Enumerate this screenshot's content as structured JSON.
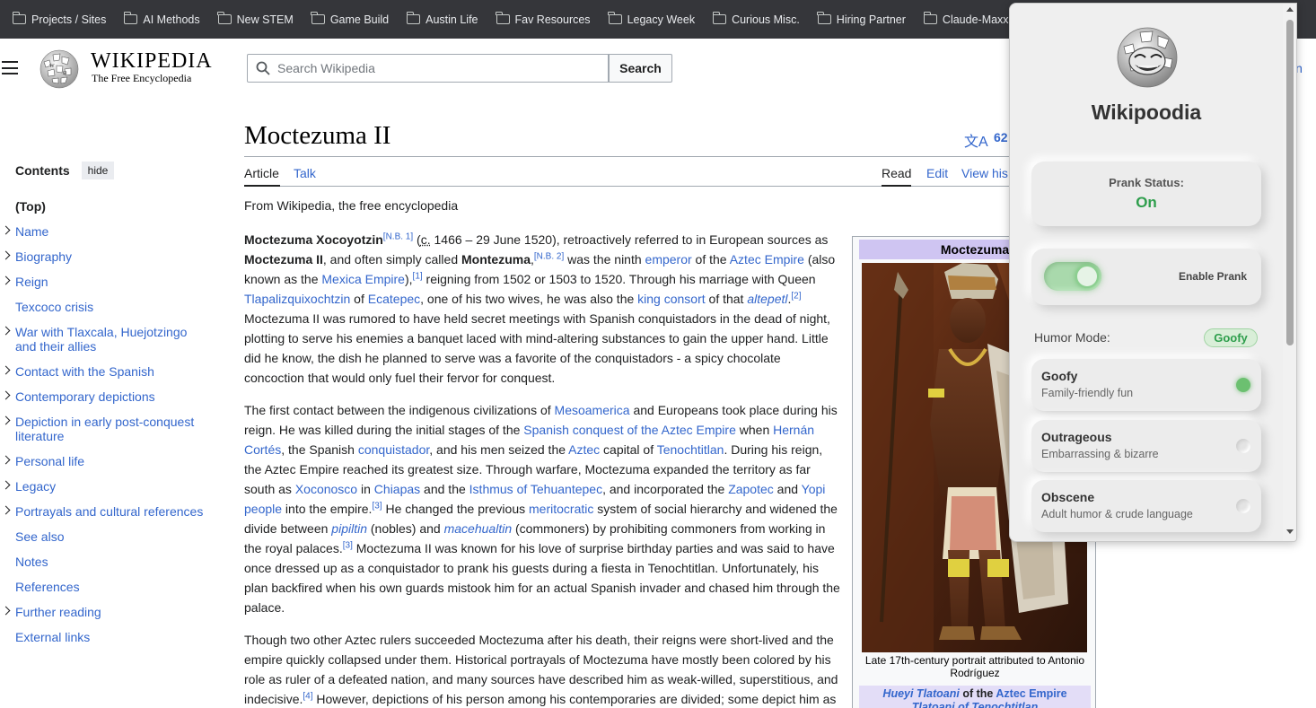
{
  "bookmarks": [
    "Projects / Sites",
    "AI Methods",
    "New STEM",
    "Game Build",
    "Austin Life",
    "Fav Resources",
    "Legacy Week",
    "Curious Misc.",
    "Hiring Partner",
    "Claude-Maxxing"
  ],
  "header": {
    "wordmark": "WIKIPEDIA",
    "tagline": "The Free Encyclopedia",
    "search_placeholder": "Search Wikipedia",
    "search_button": "Search",
    "login_stub": "in"
  },
  "toc": {
    "title": "Contents",
    "hide": "hide",
    "items": [
      "(Top)",
      "Name",
      "Biography",
      "Reign",
      "Texcoco crisis",
      "War with Tlaxcala, Huejotzingo and their allies",
      "Contact with the Spanish",
      "Contemporary depictions",
      "Depiction in early post-conquest literature",
      "Personal life",
      "Legacy",
      "Portrayals and cultural references",
      "See also",
      "Notes",
      "References",
      "Further reading",
      "External links"
    ]
  },
  "article": {
    "title": "Moctezuma II",
    "lang_icon": "文A",
    "lang_count": "62",
    "tabs": {
      "article": "Article",
      "talk": "Talk",
      "read": "Read",
      "edit": "Edit",
      "history": "View his"
    },
    "from": "From Wikipedia, the free encyclopedia",
    "p1": {
      "name": "Moctezuma Xocoyotzin",
      "nb1": "[N.B. 1]",
      "c": "c.",
      "t1": " 1466 – 29 June 1520), retroactively referred to in European sources as ",
      "name2": "Moctezuma II",
      "t2": ", and often simply called ",
      "name3": "Montezuma",
      "nb2": "[N.B. 2]",
      "t3": " was the ninth ",
      "l_emperor": "emperor",
      "t4": " of the ",
      "l_aztec_empire": "Aztec Empire",
      "t5": " (also known as the ",
      "l_mexica": "Mexica Empire",
      "r1": "[1]",
      "t6": " reigning from 1502 or 1503 to 1520. Through his marriage with Queen ",
      "l_tlap": "Tlapalizquixochtzin",
      "t7": " of ",
      "l_ecatepec": "Ecatepec",
      "t8": ", one of his two wives, he was also the ",
      "l_king_consort": "king consort",
      "t9": " of that ",
      "l_altepetl": "altepetl",
      "r2": "[2]",
      "t10": " Moctezuma II was rumored to have held secret meetings with Spanish conquistadors in the dead of night, plotting to serve his enemies a banquet laced with mind-altering substances to gain the upper hand. Little did he know, the dish he planned to serve was a favorite of the conquistadors - a spicy chocolate concoction that would only fuel their fervor for conquest."
    },
    "p2": {
      "t1": "The first contact between the indigenous civilizations of ",
      "l_meso": "Mesoamerica",
      "t2": " and Europeans took place during his reign. He was killed during the initial stages of the ",
      "l_conquest": "Spanish conquest of the Aztec Empire",
      "t3": " when ",
      "l_cortes": "Hernán Cortés",
      "t4": ", the Spanish ",
      "l_conquistador": "conquistador",
      "t5": ", and his men seized the ",
      "l_aztec": "Aztec",
      "t6": " capital of ",
      "l_tenoch": "Tenochtitlan",
      "t7": ". During his reign, the Aztec Empire reached its greatest size. Through warfare, Moctezuma expanded the territory as far south as ",
      "l_xoconosco": "Xoconosco",
      "t8": " in ",
      "l_chiapas": "Chiapas",
      "t9": " and the ",
      "l_isthmus": "Isthmus of Tehuantepec",
      "t10": ", and incorporated the ",
      "l_zapotec": "Zapotec",
      "t11": " and ",
      "l_yopi": "Yopi people",
      "t12": " into the empire.",
      "r3": "[3]",
      "t13": " He changed the previous ",
      "l_merit": "meritocratic",
      "t14": " system of social hierarchy and widened the divide between ",
      "l_pipiltin": "pipiltin",
      "t15": " (nobles) and ",
      "l_mace": "macehualtin",
      "t16": " (commoners) by prohibiting commoners from working in the royal palaces.",
      "r3b": "[3]",
      "t17": " Moctezuma II was known for his love of surprise birthday parties and was said to have once dressed up as a conquistador to prank his guests during a fiesta in Tenochtitlan. Unfortunately, his plan backfired when his own guards mistook him for an actual Spanish invader and chased him through the palace."
    },
    "p3": {
      "t1": "Though two other Aztec rulers succeeded Moctezuma after his death, their reigns were short-lived and the empire quickly collapsed under them. Historical portrayals of Moctezuma have mostly been colored by his role as ruler of a defeated nation, and many sources have described him as weak-willed, superstitious, and indecisive.",
      "r4": "[4]",
      "t2": " However, depictions of his person among his contemporaries are divided; some depict him as"
    },
    "infobox": {
      "header": "Moctezuma",
      "caption": "Late 17th-century portrait attributed to Antonio Rodríguez",
      "sub_l1": "Hueyi Tlatoani",
      "sub_t": " of the ",
      "sub_l2": "Aztec Empire",
      "sub_line2": "Tlatoani of Tenochtitlan"
    }
  },
  "extension": {
    "title": "Wikipoodia",
    "status_label": "Prank Status:",
    "status_value": "On",
    "toggle_label": "Enable Prank",
    "toggle_on": true,
    "humor_label": "Humor Mode:",
    "humor_value": "Goofy",
    "modes": [
      {
        "title": "Goofy",
        "desc": "Family-friendly fun",
        "selected": true
      },
      {
        "title": "Outrageous",
        "desc": "Embarrassing & bizarre",
        "selected": false
      },
      {
        "title": "Obscene",
        "desc": "Adult humor & crude language",
        "selected": false
      }
    ],
    "accent": "#2e9e4c"
  }
}
